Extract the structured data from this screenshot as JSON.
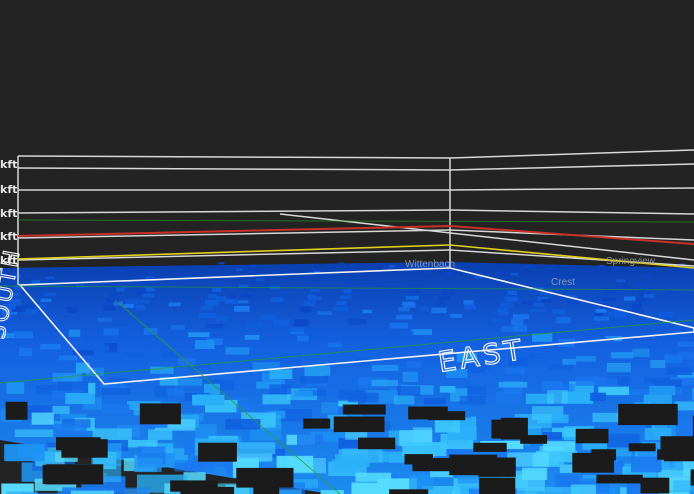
{
  "viewer": {
    "altitude_labels": [
      "kft",
      "kft",
      "kft",
      "kft",
      "kft"
    ],
    "station_labels": [
      "Wittenbach",
      "Springview",
      "Crest"
    ],
    "direction_labels": {
      "east": "EAST",
      "south": "SOUTH"
    },
    "colors": {
      "background": "#232323",
      "grid": "#d8d8d8",
      "red_line": "#c8302a",
      "yellow_line": "#e0d020",
      "green_line": "#2f8f2f"
    }
  }
}
